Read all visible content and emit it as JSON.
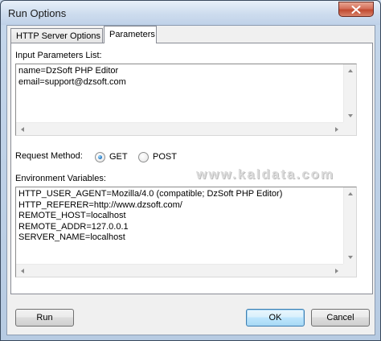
{
  "window": {
    "title": "Run Options"
  },
  "tabs": [
    {
      "label": "HTTP Server Options",
      "active": false
    },
    {
      "label": "Parameters",
      "active": true
    }
  ],
  "params": {
    "label": "Input Parameters List:",
    "lines": [
      "name=DzSoft PHP Editor",
      "email=support@dzsoft.com"
    ]
  },
  "request_method": {
    "label": "Request Method:",
    "options": [
      {
        "label": "GET",
        "selected": true
      },
      {
        "label": "POST",
        "selected": false
      }
    ]
  },
  "watermark": "www.kaldata.com",
  "env": {
    "label": "Environment Variables:",
    "lines": [
      "HTTP_USER_AGENT=Mozilla/4.0 (compatible; DzSoft PHP Editor)",
      "HTTP_REFERER=http://www.dzsoft.com/",
      "REMOTE_HOST=localhost",
      "REMOTE_ADDR=127.0.0.1",
      "SERVER_NAME=localhost"
    ]
  },
  "buttons": {
    "run": "Run",
    "ok": "OK",
    "cancel": "Cancel"
  },
  "colors": {
    "close_button": "#c75a44",
    "radio_dot": "#1a6fbf"
  }
}
